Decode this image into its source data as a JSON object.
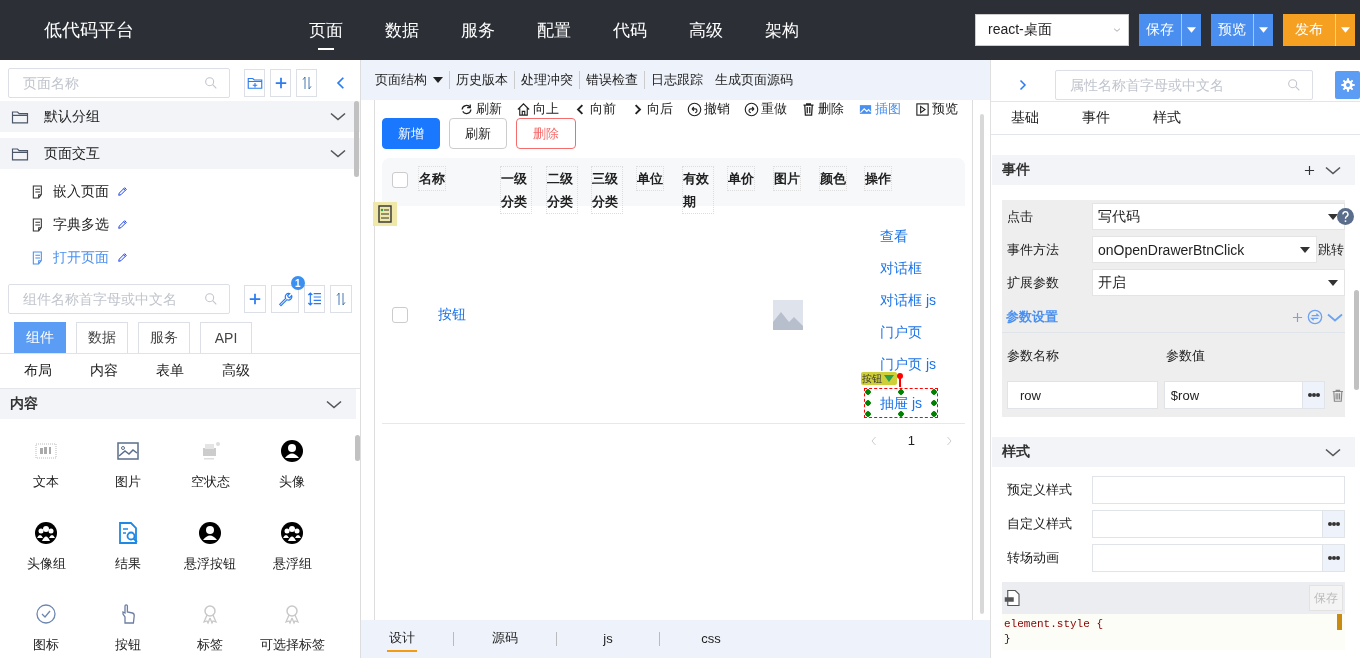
{
  "app_title": "低代码平台",
  "nav": [
    {
      "label": "页面",
      "selected": true
    },
    {
      "label": "数据",
      "selected": false
    },
    {
      "label": "服务",
      "selected": false
    },
    {
      "label": "配置",
      "selected": false
    },
    {
      "label": "代码",
      "selected": false
    },
    {
      "label": "高级",
      "selected": false
    },
    {
      "label": "架构",
      "selected": false
    }
  ],
  "platform_select": {
    "value": "react-桌面"
  },
  "actions": [
    {
      "label": "保存",
      "kind": "primary"
    },
    {
      "label": "预览",
      "kind": "primary"
    },
    {
      "label": "发布",
      "kind": "publish"
    }
  ],
  "page_panel": {
    "search": {
      "placeholder": "页面名称"
    },
    "groups": [
      {
        "label": "默认分组"
      },
      {
        "label": "页面交互",
        "pages": [
          {
            "label": "嵌入页面",
            "selected": false
          },
          {
            "label": "字典多选",
            "selected": false
          },
          {
            "label": "打开页面",
            "selected": true
          }
        ]
      }
    ]
  },
  "component_panel": {
    "search": {
      "placeholder": "组件名称首字母或中文名"
    },
    "badge": "1",
    "tabs": [
      {
        "label": "组件",
        "selected": true
      },
      {
        "label": "数据",
        "selected": false
      },
      {
        "label": "服务",
        "selected": false
      },
      {
        "label": "API",
        "selected": false
      }
    ],
    "categories": [
      "布局",
      "内容",
      "表单",
      "高级"
    ],
    "section": "内容",
    "items": [
      "文本",
      "图片",
      "空状态",
      "头像",
      "头像组",
      "结果",
      "悬浮按钮",
      "悬浮组",
      "图标",
      "按钮",
      "标签",
      "可选择标签"
    ]
  },
  "editor": {
    "menu": [
      {
        "label": "页面结构",
        "has_menu": true,
        "divider": true
      },
      {
        "label": "历史版本",
        "has_menu": false,
        "divider": true
      },
      {
        "label": "处理冲突",
        "has_menu": false,
        "divider": true
      },
      {
        "label": "错误检查",
        "has_menu": false,
        "divider": true
      },
      {
        "label": "日志跟踪",
        "has_menu": false,
        "divider": false
      },
      {
        "label": "生成页面源码",
        "has_menu": false,
        "divider": false
      }
    ],
    "tools": [
      {
        "label": "刷新",
        "active": false
      },
      {
        "label": "向上",
        "active": false
      },
      {
        "label": "向前",
        "active": false
      },
      {
        "label": "向后",
        "active": false
      },
      {
        "label": "撤销",
        "active": false
      },
      {
        "label": "重做",
        "active": false
      },
      {
        "label": "删除",
        "active": false
      },
      {
        "label": "插图",
        "active": true
      },
      {
        "label": "预览",
        "active": false
      }
    ],
    "buttons": [
      {
        "label": "新增",
        "kind": "primary"
      },
      {
        "label": "刷新",
        "kind": "default"
      },
      {
        "label": "删除",
        "kind": "danger"
      }
    ],
    "table": {
      "header_checked": false,
      "columns": [
        "名称",
        "一级分类",
        "二级分类",
        "三级分类",
        "单位",
        "有效期",
        "单价",
        "图片",
        "颜色",
        "操作"
      ],
      "rows": [
        {
          "checked": false,
          "name": "按钮",
          "picture": true,
          "actions": [
            {
              "label": "查看",
              "selected": false
            },
            {
              "label": "对话框",
              "selected": false
            },
            {
              "label": "对话框 js",
              "selected": false
            },
            {
              "label": "门户页",
              "selected": false
            },
            {
              "label": "门户页 js",
              "selected": false
            },
            {
              "label": "抽屉 js",
              "selected": true
            }
          ]
        }
      ]
    },
    "selection_tag": "按钮",
    "pagination": {
      "page": "1"
    },
    "view_tabs": [
      {
        "label": "设计",
        "selected": true
      },
      {
        "label": "源码",
        "selected": false
      },
      {
        "label": "js",
        "selected": false
      },
      {
        "label": "css",
        "selected": false
      }
    ]
  },
  "properties": {
    "search": {
      "placeholder": "属性名称首字母或中文名"
    },
    "tabs": [
      {
        "label": "基础",
        "selected": false
      },
      {
        "label": "事件",
        "selected": false
      },
      {
        "label": "样式",
        "selected": false
      }
    ],
    "events": {
      "title": "事件",
      "fields": [
        {
          "label": "点击",
          "value": "写代码",
          "help": true
        },
        {
          "label": "事件方法",
          "value": "onOpenDrawerBtnClick",
          "link": "跳转",
          "help": false
        },
        {
          "label": "扩展参数",
          "value": "开启",
          "help": false
        }
      ],
      "params": {
        "title": "参数设置",
        "name_header": "参数名称",
        "value_header": "参数值",
        "rows": [
          {
            "name": "row",
            "value": "$row"
          }
        ]
      }
    },
    "style": {
      "title": "样式",
      "fields": [
        {
          "label": "预定义样式",
          "kind": "text"
        },
        {
          "label": "自定义样式",
          "kind": "editor"
        },
        {
          "label": "转场动画",
          "kind": "editor"
        }
      ],
      "code": {
        "save": "保存",
        "save_disabled": true,
        "lines": [
          "element.style {",
          "}"
        ]
      }
    }
  }
}
